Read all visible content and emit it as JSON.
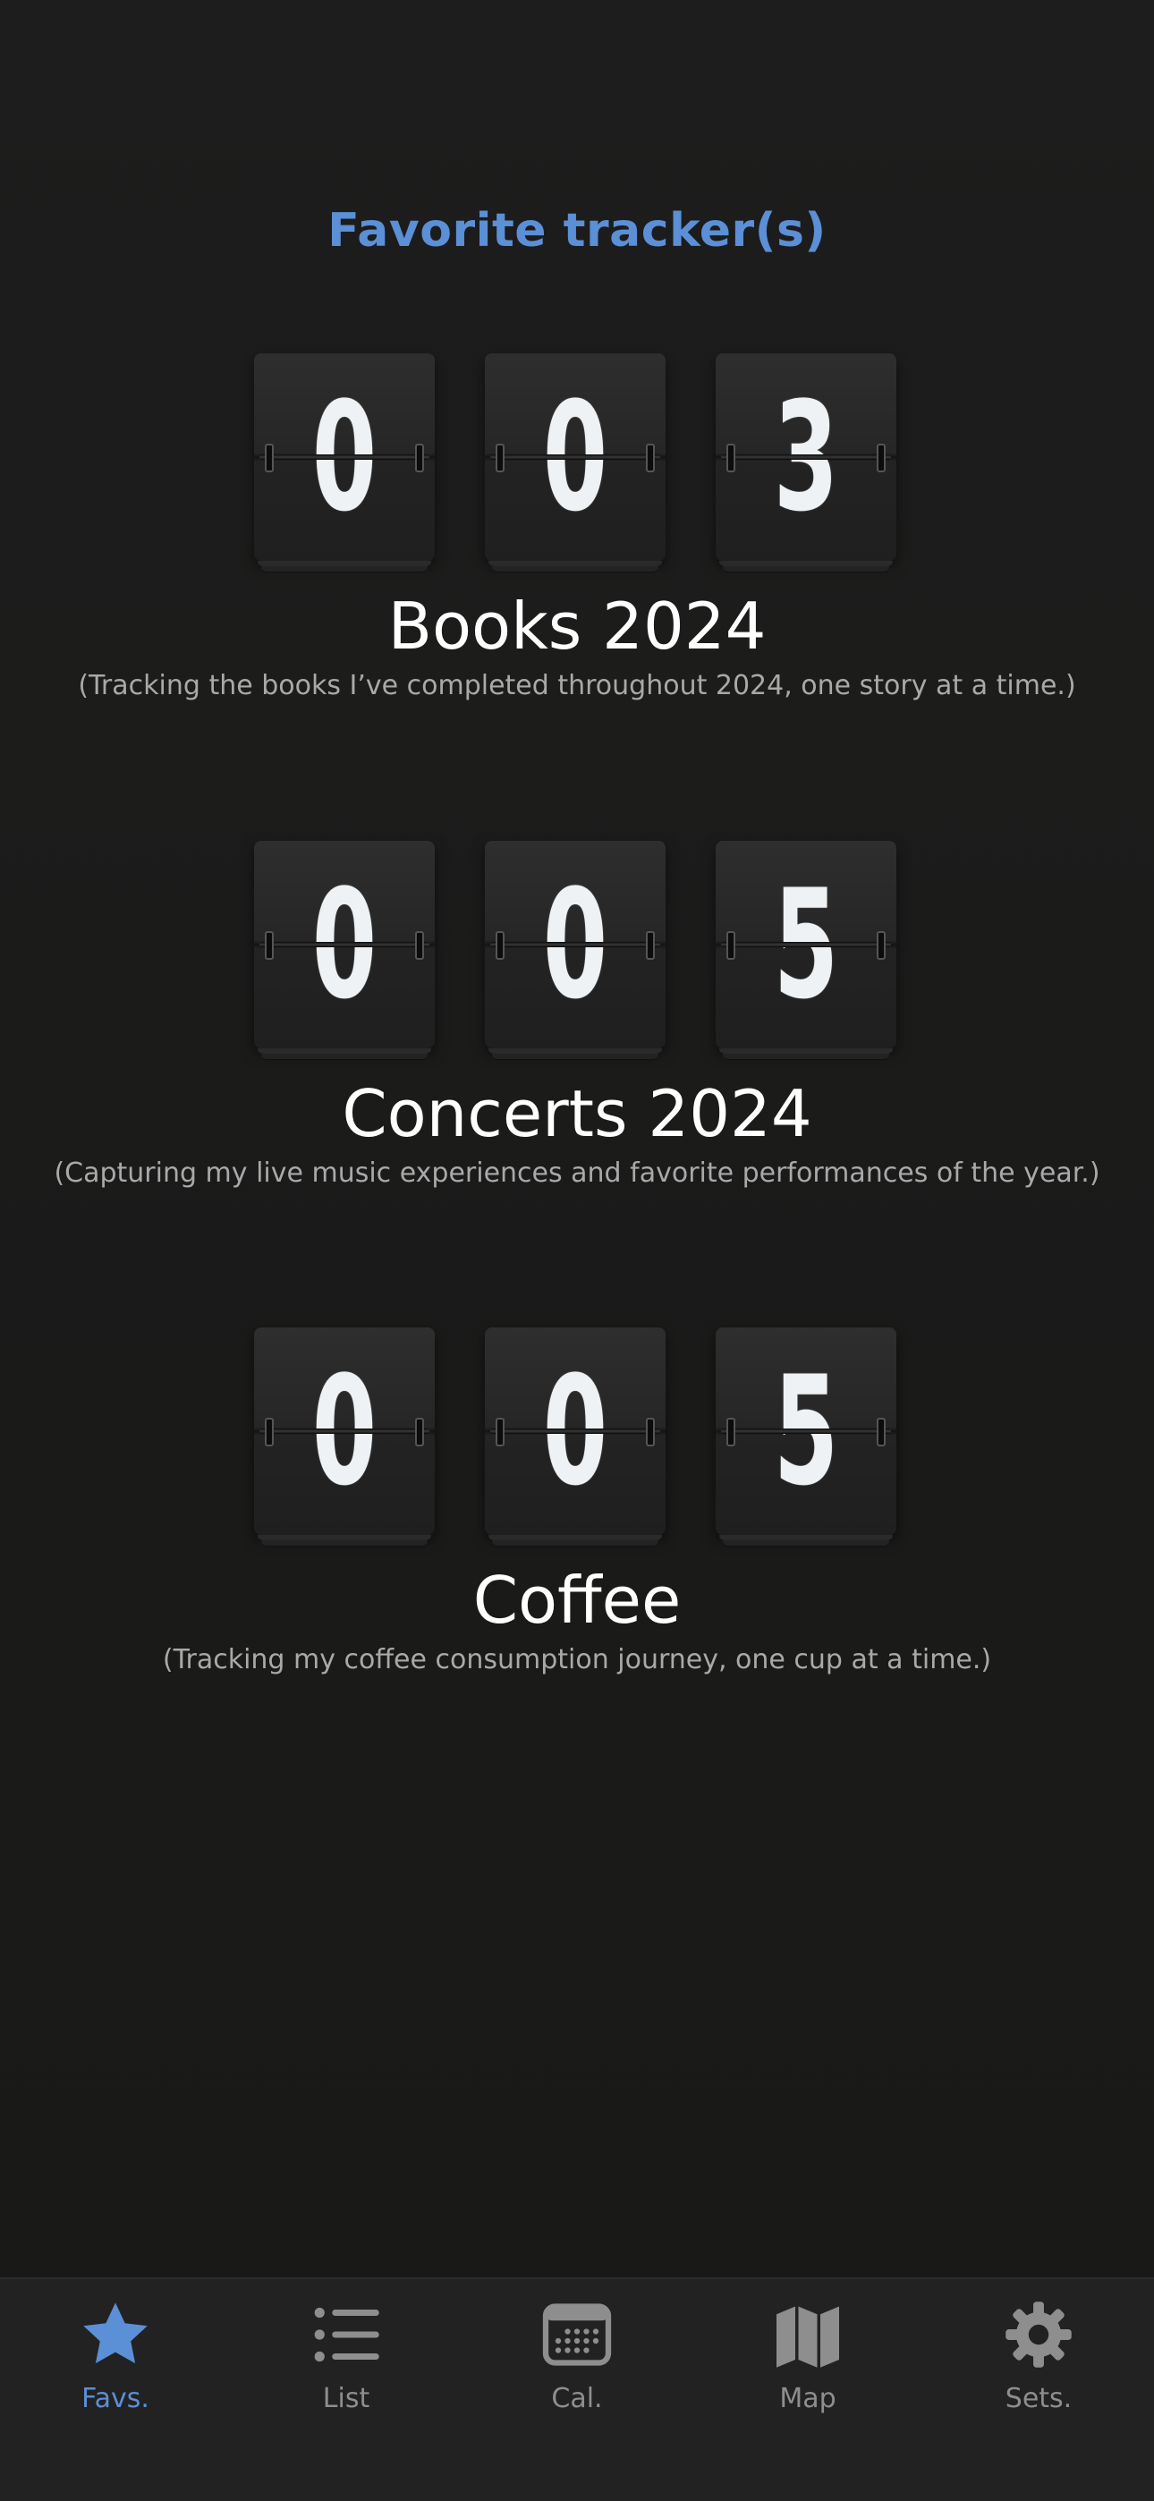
{
  "header": {
    "title": "Favorite tracker(s)"
  },
  "trackers": [
    {
      "digits": [
        "0",
        "0",
        "3"
      ],
      "name": "Books 2024",
      "description": "(Tracking the books I’ve completed throughout 2024, one story at a time.)"
    },
    {
      "digits": [
        "0",
        "0",
        "5"
      ],
      "name": "Concerts 2024",
      "description": "(Capturing my live music experiences and favorite performances of the year.)"
    },
    {
      "digits": [
        "0",
        "0",
        "5"
      ],
      "name": "Coffee",
      "description": "(Tracking my coffee consumption journey, one cup at a time.)"
    }
  ],
  "tabbar": {
    "accent": "#5b8fd6",
    "inactive": "#8e8e8e",
    "items": [
      {
        "label": "Favs.",
        "icon": "star-icon",
        "active": true
      },
      {
        "label": "List",
        "icon": "list-icon",
        "active": false
      },
      {
        "label": "Cal.",
        "icon": "calendar-icon",
        "active": false
      },
      {
        "label": "Map",
        "icon": "map-icon",
        "active": false
      },
      {
        "label": "Sets.",
        "icon": "gear-icon",
        "active": false
      }
    ]
  }
}
